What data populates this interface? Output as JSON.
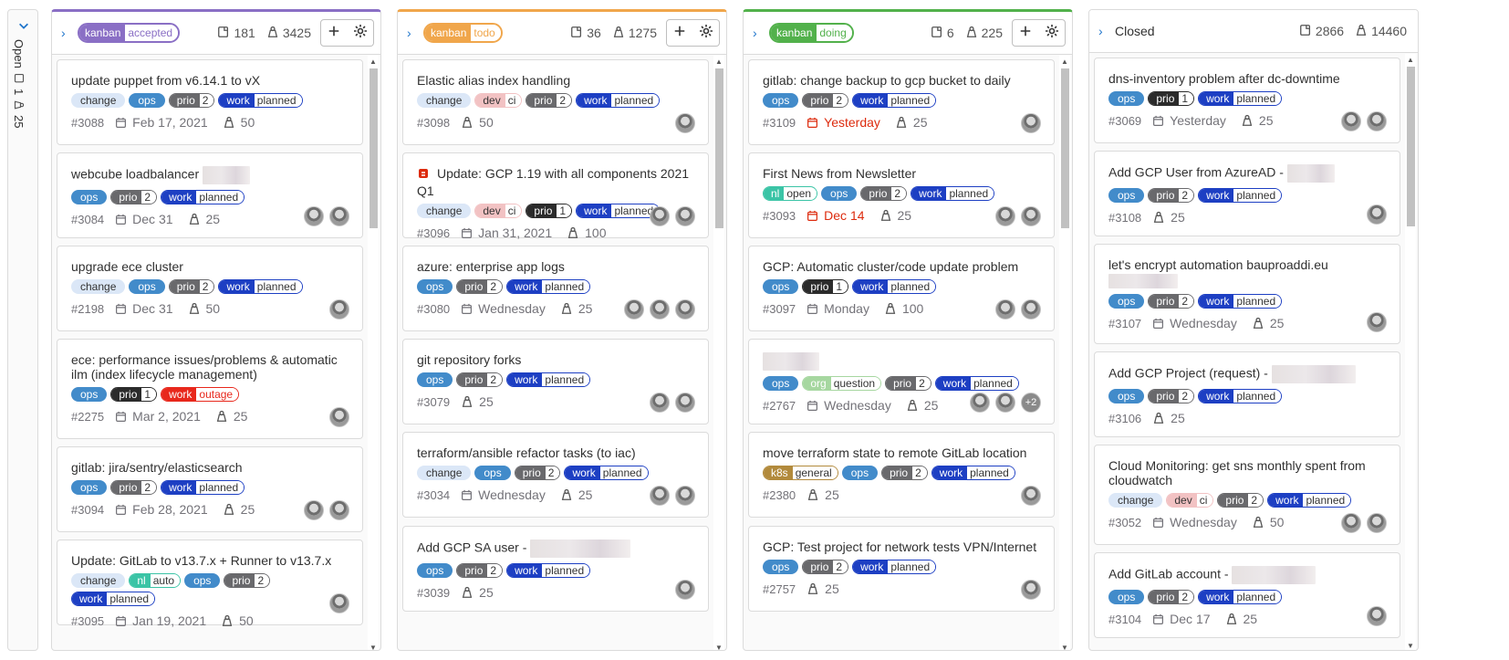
{
  "open_rail": {
    "label": "Open",
    "issues": "1",
    "weight": "25"
  },
  "columns": [
    {
      "key": "kanban",
      "value": "accepted",
      "color": "#8a6fc5",
      "issues": "181",
      "weight": "3425",
      "cards": [
        {
          "title": "update puppet from v6.14.1 to vX",
          "labels": [
            [
              "change"
            ],
            [
              "ops"
            ],
            [
              "prio",
              "2"
            ],
            [
              "work",
              "planned"
            ]
          ],
          "number": "#3088",
          "date": "Feb 17, 2021",
          "weight": "50",
          "avatars": 0
        },
        {
          "title": "webcube loadbalancer",
          "blur": 52,
          "labels": [
            [
              "ops"
            ],
            [
              "prio",
              "2"
            ],
            [
              "work",
              "planned"
            ]
          ],
          "number": "#3084",
          "date": "Dec 31",
          "weight": "25",
          "avatars": 2
        },
        {
          "title": "upgrade ece cluster",
          "labels": [
            [
              "change"
            ],
            [
              "ops"
            ],
            [
              "prio",
              "2"
            ],
            [
              "work",
              "planned"
            ]
          ],
          "number": "#2198",
          "date": "Dec 31",
          "weight": "50",
          "avatars": 1
        },
        {
          "title": "ece: performance issues/problems & automatic ilm (index lifecycle management)",
          "labels": [
            [
              "ops"
            ],
            [
              "prio",
              "1"
            ],
            [
              "work",
              "outage"
            ]
          ],
          "number": "#2275",
          "date": "Mar 2, 2021",
          "weight": "25",
          "avatars": 1
        },
        {
          "title": "gitlab: jira/sentry/elasticsearch",
          "labels": [
            [
              "ops"
            ],
            [
              "prio",
              "2"
            ],
            [
              "work",
              "planned"
            ]
          ],
          "number": "#3094",
          "date": "Feb 28, 2021",
          "weight": "25",
          "avatars": 2
        },
        {
          "title": "Update: GitLab to v13.7.x + Runner to v13.7.x",
          "labels": [
            [
              "change"
            ],
            [
              "nl",
              "auto"
            ],
            [
              "ops"
            ],
            [
              "prio",
              "2"
            ],
            [
              "work",
              "planned"
            ]
          ],
          "number": "#3095",
          "date": "Jan 19, 2021",
          "weight": "50",
          "avatars": 1
        }
      ]
    },
    {
      "key": "kanban",
      "value": "todo",
      "color": "#f0a64b",
      "issues": "36",
      "weight": "1275",
      "cards": [
        {
          "title": "Elastic alias index handling",
          "labels": [
            [
              "change"
            ],
            [
              "dev",
              "ci"
            ],
            [
              "prio",
              "2"
            ],
            [
              "work",
              "planned"
            ]
          ],
          "number": "#3098",
          "date": "",
          "weight": "50",
          "avatars": 1
        },
        {
          "title": "Update: GCP 1.19 with all components 2021 Q1",
          "icon": true,
          "labels": [
            [
              "change"
            ],
            [
              "dev",
              "ci"
            ],
            [
              "prio",
              "1"
            ],
            [
              "work",
              "planned"
            ]
          ],
          "number": "#3096",
          "date": "Jan 31, 2021",
          "weight": "100",
          "avatars": 2
        },
        {
          "title": "azure: enterprise app logs",
          "labels": [
            [
              "ops"
            ],
            [
              "prio",
              "2"
            ],
            [
              "work",
              "planned"
            ]
          ],
          "number": "#3080",
          "date": "Wednesday",
          "weight": "25",
          "avatars": 3
        },
        {
          "title": "git repository forks",
          "labels": [
            [
              "ops"
            ],
            [
              "prio",
              "2"
            ],
            [
              "work",
              "planned"
            ]
          ],
          "number": "#3079",
          "date": "",
          "weight": "25",
          "avatars": 2
        },
        {
          "title": "terraform/ansible refactor tasks (to iac)",
          "labels": [
            [
              "change"
            ],
            [
              "ops"
            ],
            [
              "prio",
              "2"
            ],
            [
              "work",
              "planned"
            ]
          ],
          "number": "#3034",
          "date": "Wednesday",
          "weight": "25",
          "avatars": 2
        },
        {
          "title": "Add GCP SA user -",
          "blur": 110,
          "labels": [
            [
              "ops"
            ],
            [
              "prio",
              "2"
            ],
            [
              "work",
              "planned"
            ]
          ],
          "number": "#3039",
          "date": "",
          "weight": "25",
          "avatars": 1
        }
      ]
    },
    {
      "key": "kanban",
      "value": "doing",
      "color": "#52b14b",
      "issues": "6",
      "weight": "225",
      "cards": [
        {
          "title": "gitlab: change backup to gcp bucket to daily",
          "labels": [
            [
              "ops"
            ],
            [
              "prio",
              "2"
            ],
            [
              "work",
              "planned"
            ]
          ],
          "number": "#3109",
          "date": "Yesterday",
          "red": true,
          "weight": "25",
          "avatars": 1
        },
        {
          "title": "First News from Newsletter",
          "labels": [
            [
              "nl",
              "open"
            ],
            [
              "ops"
            ],
            [
              "prio",
              "2"
            ],
            [
              "work",
              "planned"
            ]
          ],
          "number": "#3093",
          "date": "Dec 14",
          "red": true,
          "weight": "25",
          "avatars": 2
        },
        {
          "title": "GCP: Automatic cluster/code update problem",
          "labels": [
            [
              "ops"
            ],
            [
              "prio",
              "1"
            ],
            [
              "work",
              "planned"
            ]
          ],
          "number": "#3097",
          "date": "Monday",
          "weight": "100",
          "avatars": 2
        },
        {
          "title": "",
          "blur": 62,
          "labels": [
            [
              "ops"
            ],
            [
              "org",
              "question"
            ],
            [
              "prio",
              "2"
            ],
            [
              "work",
              "planned"
            ]
          ],
          "number": "#2767",
          "date": "Wednesday",
          "weight": "25",
          "avatars": 2,
          "more": "+2"
        },
        {
          "title": "move terraform state to remote GitLab location",
          "labels": [
            [
              "k8s",
              "general"
            ],
            [
              "ops"
            ],
            [
              "prio",
              "2"
            ],
            [
              "work",
              "planned"
            ]
          ],
          "number": "#2380",
          "date": "",
          "weight": "25",
          "avatars": 1
        },
        {
          "title": "GCP: Test project for network tests VPN/Internet",
          "labels": [
            [
              "ops"
            ],
            [
              "prio",
              "2"
            ],
            [
              "work",
              "planned"
            ]
          ],
          "number": "#2757",
          "date": "",
          "weight": "25",
          "avatars": 1
        }
      ]
    },
    {
      "key": "",
      "value": "Closed",
      "color": "",
      "issues": "2866",
      "weight": "14460",
      "cards": [
        {
          "title": "dns-inventory problem after dc-downtime",
          "labels": [
            [
              "ops"
            ],
            [
              "prio",
              "1"
            ],
            [
              "work",
              "planned"
            ]
          ],
          "number": "#3069",
          "date": "Yesterday",
          "weight": "25",
          "avatars": 2
        },
        {
          "title": "Add GCP User from AzureAD -",
          "blur": 52,
          "labels": [
            [
              "ops"
            ],
            [
              "prio",
              "2"
            ],
            [
              "work",
              "planned"
            ]
          ],
          "number": "#3108",
          "date": "",
          "weight": "25",
          "avatars": 1
        },
        {
          "title": "let's encrypt automation bauproaddi.eu",
          "blurLine": 76,
          "labels": [
            [
              "ops"
            ],
            [
              "prio",
              "2"
            ],
            [
              "work",
              "planned"
            ]
          ],
          "number": "#3107",
          "date": "Wednesday",
          "weight": "25",
          "avatars": 1
        },
        {
          "title": "Add GCP Project (request) -",
          "blur": 92,
          "labels": [
            [
              "ops"
            ],
            [
              "prio",
              "2"
            ],
            [
              "work",
              "planned"
            ]
          ],
          "number": "#3106",
          "date": "",
          "weight": "25",
          "avatars": 0
        },
        {
          "title": "Cloud Monitoring: get sns monthly spent from cloudwatch",
          "labels": [
            [
              "change"
            ],
            [
              "dev",
              "ci"
            ],
            [
              "prio",
              "2"
            ],
            [
              "work",
              "planned"
            ]
          ],
          "number": "#3052",
          "date": "Wednesday",
          "weight": "50",
          "avatars": 2
        },
        {
          "title": "Add GitLab account -",
          "blur": 92,
          "labels": [
            [
              "ops"
            ],
            [
              "prio",
              "2"
            ],
            [
              "work",
              "planned"
            ]
          ],
          "number": "#3104",
          "date": "Dec 17",
          "weight": "25",
          "avatars": 1
        }
      ]
    }
  ],
  "label_colors": {
    "change": {
      "bg": "#dbe7f7",
      "fg": "#333"
    },
    "ops": {
      "bg": "#428bca",
      "fg": "#fff"
    },
    "prio": {
      "bg": "#69696c",
      "border": "#69696c"
    },
    "prio1": {
      "bg": "#2b2b2b",
      "border": "#2b2b2b"
    },
    "work": {
      "bg": "#1d3fc3",
      "border": "#1d3fc3"
    },
    "outage": {
      "bg": "#e8281c",
      "border": "#e8281c"
    },
    "dev": {
      "bg": "#f2c2c3",
      "border": "#f2c2c3"
    },
    "nl": {
      "bg": "#3bc4a6",
      "border": "#3bc4a6"
    },
    "org": {
      "bg": "#a6d7a0",
      "border": "#a6d7a0"
    },
    "k8s": {
      "bg": "#b28a3c",
      "border": "#b28a3c"
    }
  }
}
